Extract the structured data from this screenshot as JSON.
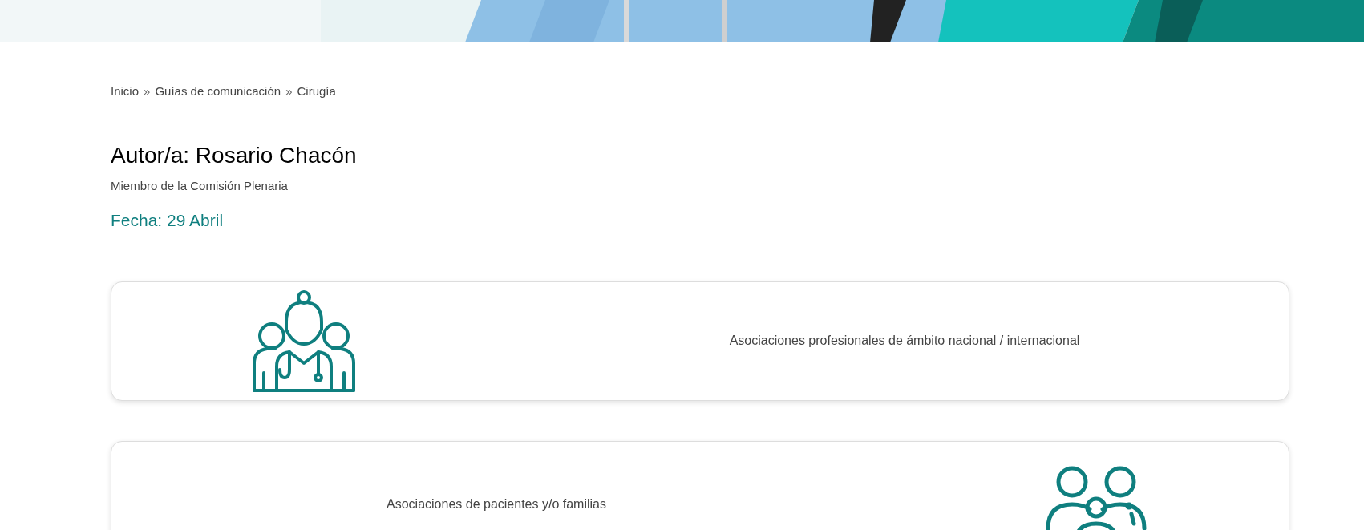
{
  "breadcrumb": {
    "items": [
      "Inicio",
      "Guías de comunicación",
      "Cirugía"
    ],
    "separator": "»"
  },
  "author": {
    "title": "Autor/a: Rosario Chacón",
    "role": "Miembro de la Comisión Plenaria"
  },
  "date": "Fecha: 29 Abril",
  "cards": [
    {
      "label": "Asociaciones profesionales de ámbito nacional / internacional",
      "kind": "leading"
    },
    {
      "label": "Asociaciones de pacientes y/o familias",
      "kind": "trailing"
    }
  ]
}
